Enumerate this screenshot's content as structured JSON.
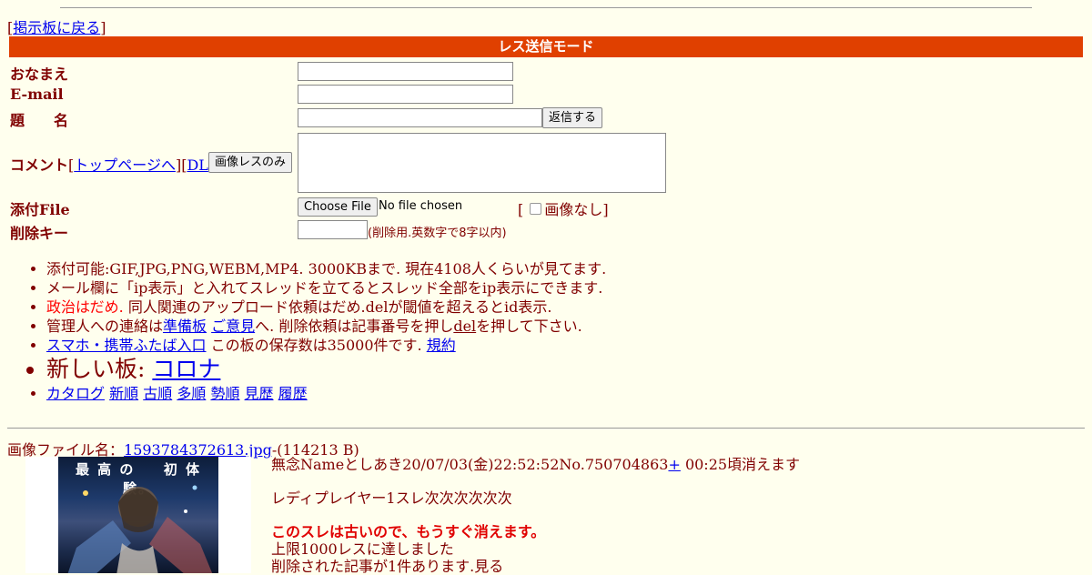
{
  "nav": {
    "back_label": "掲示板に戻る",
    "bracket_open": "[",
    "bracket_close": "]"
  },
  "mode_title": "レス送信モード",
  "form": {
    "name_label": "おなまえ",
    "email_label": "E-mail",
    "subject_label": "題　　名",
    "submit_label": "返信する",
    "comment_label": "コメント",
    "top_link": "トップページへ",
    "dl_link": "DL",
    "image_only_label": "画像レスのみ",
    "file_label": "添付File",
    "choose_file_label": "Choose File",
    "no_file_text": "No file chosen",
    "no_image_label": "画像なし",
    "delkey_label": "削除キー",
    "delkey_note": "(削除用.英数字で8字以内)"
  },
  "rules": {
    "line1": "添付可能:GIF,JPG,PNG,WEBM,MP4. 3000KBまで. 現在4108人くらいが見てます.",
    "line2": "メール欄に「ip表示」と入れてスレッドを立てるとスレッド全部をip表示にできます.",
    "line3_red": "政治はだめ.",
    "line3_rest": " 同人関連のアップロード依頼はだめ.delが閾値を超えるとid表示.",
    "line4_pre": "管理人への連絡は",
    "line4_link1": "準備板",
    "line4_link2": "ご意見",
    "line4_mid": "へ. 削除依頼は記事番号を押し",
    "line4_del": "del",
    "line4_post": "を押して下さい.",
    "line5_link": "スマホ・携帯ふたば入口",
    "line5_mid": " この板の保存数は35000件です. ",
    "line5_link2": "規約",
    "line6_pre": "新しい板: ",
    "line6_link": "コロナ",
    "sort_links": [
      "カタログ",
      "新順",
      "古順",
      "多順",
      "勢順",
      "見歴",
      "履歴"
    ]
  },
  "image_file": {
    "prefix": "画像ファイル名：",
    "filename": "1593784372613.jpg",
    "size": "-(114213 B)"
  },
  "thumbnail": {
    "poster_text": "最 高 の 　 初 体 験。"
  },
  "post": {
    "header": "無念Nameとしあき20/07/03(金)22:52:52No.750704863",
    "plus": "+",
    "expire": " 00:25頃消えます",
    "body": "レディプレイヤー1スレ次次次次次次",
    "old_notice": "このスレは古いので、もうすぐ消えます。",
    "limit_notice": "上限1000レスに達しました",
    "deleted_notice": "削除された記事が1件あります.見る"
  }
}
